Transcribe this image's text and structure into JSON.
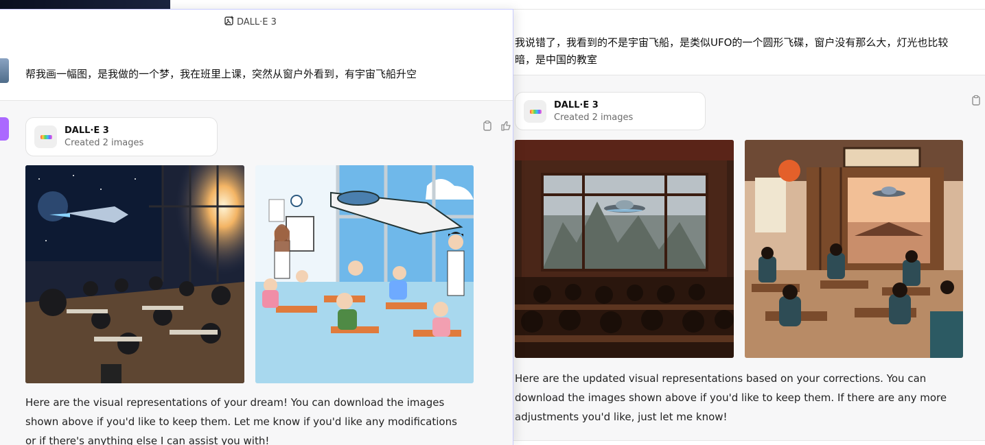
{
  "left": {
    "header_title": "DALL·E 3",
    "user_message": "帮我画一幅图，是我做的一个梦，我在班里上课，突然从窗户外看到，有宇宙飞船升空",
    "tool_name": "DALL·E 3",
    "tool_status": "Created 2 images",
    "images": [
      "classroom-spaceship-realistic",
      "classroom-spaceship-cartoon"
    ],
    "caption": "Here are the visual representations of your dream! You can download the images shown above if you'd like to keep them. Let me know if you'd like any modifications or if there's anything else I can assist you with!"
  },
  "right": {
    "user_message": "我说错了，我看到的不是宇宙飞船，是类似UFO的一个圆形飞碟，窗户没有那么大，灯光也比较暗，是中国的教室",
    "tool_name": "DALL·E 3",
    "tool_status": "Created 2 images",
    "images": [
      "chinese-classroom-ufo-dim",
      "chinese-classroom-ufo-traditional"
    ],
    "caption": "Here are the updated visual representations based on your corrections. You can download the images shown above if you'd like to keep them. If there are any more adjustments you'd like, just let me know!"
  },
  "icons": {
    "copy": "clipboard-icon",
    "like": "thumbs-up-icon",
    "header": "image-generate-icon"
  }
}
